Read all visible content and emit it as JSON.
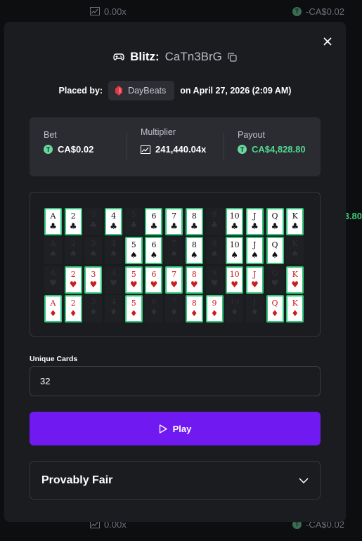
{
  "background": {
    "top_row": {
      "multiplier": "0.00x",
      "payout": "-CA$0.02"
    },
    "bottom_row": {
      "multiplier": "0.00x",
      "payout": "-CA$0.02"
    },
    "side_value": "3.80"
  },
  "modal": {
    "game_name": "Blitz:",
    "bet_code": "CaTn3BrG",
    "placed_by_label": "Placed by:",
    "username": "DayBeats",
    "placed_on": "on April 27, 2026 (2:09 AM)",
    "stats": {
      "bet_label": "Bet",
      "bet_value": "CA$0.02",
      "multiplier_label": "Multiplier",
      "multiplier_value": "241,440.04x",
      "payout_label": "Payout",
      "payout_value": "CA$4,828.80"
    },
    "unique_cards_label": "Unique Cards",
    "unique_cards_value": "32",
    "play_label": "Play",
    "provably_fair_label": "Provably Fair",
    "colors": {
      "accent": "#7019f0",
      "win": "#53d68d",
      "card_border": "#34c77b"
    }
  },
  "cards": {
    "ranks": [
      "A",
      "2",
      "3",
      "4",
      "5",
      "6",
      "7",
      "8",
      "9",
      "10",
      "J",
      "Q",
      "K"
    ],
    "rows": [
      {
        "suit": "clubs",
        "symbol": "♣",
        "red": false,
        "selected": [
          1,
          1,
          0,
          1,
          0,
          1,
          1,
          1,
          0,
          1,
          1,
          1,
          1
        ]
      },
      {
        "suit": "spades",
        "symbol": "♠",
        "red": false,
        "selected": [
          0,
          0,
          0,
          0,
          1,
          1,
          0,
          1,
          0,
          1,
          1,
          1,
          0
        ]
      },
      {
        "suit": "hearts",
        "symbol": "♥",
        "red": true,
        "selected": [
          0,
          1,
          1,
          0,
          1,
          1,
          1,
          1,
          0,
          1,
          1,
          0,
          1
        ]
      },
      {
        "suit": "diamonds",
        "symbol": "♦",
        "red": true,
        "selected": [
          1,
          1,
          0,
          0,
          1,
          0,
          0,
          1,
          1,
          0,
          0,
          1,
          1
        ]
      }
    ]
  }
}
